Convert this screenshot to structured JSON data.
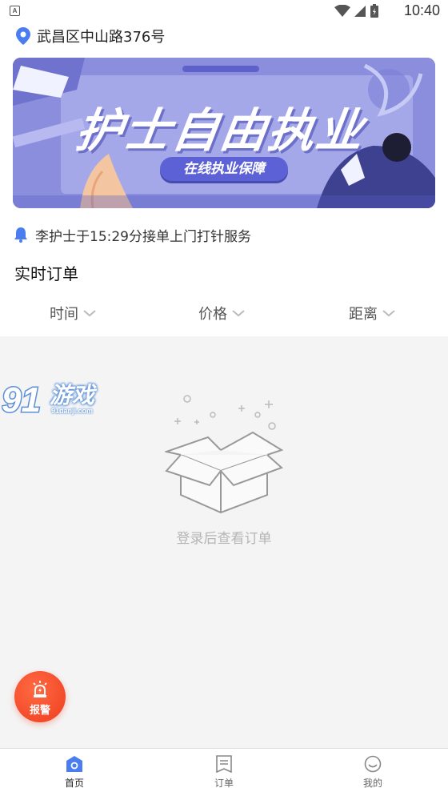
{
  "status_bar": {
    "app_badge": "A",
    "time": "10:40"
  },
  "location": {
    "address": "武昌区中山路376号",
    "icon": "location-pin-icon"
  },
  "banner": {
    "title": "护士自由执业",
    "subtitle": "在线执业保障"
  },
  "notice": {
    "text": "李护士于15:29分接单上门打针服务",
    "icon": "bell-icon"
  },
  "section": {
    "title": "实时订单"
  },
  "filters": [
    {
      "label": "时间"
    },
    {
      "label": "价格"
    },
    {
      "label": "距离"
    }
  ],
  "empty_state": {
    "text": "登录后查看订单"
  },
  "watermark": {
    "brand": "游戏",
    "site": "91danji.com"
  },
  "alarm_button": {
    "label": "报警"
  },
  "tabbar": {
    "items": [
      {
        "label": "首页",
        "active": true,
        "icon": "home-icon"
      },
      {
        "label": "订单",
        "active": false,
        "icon": "order-list-icon"
      },
      {
        "label": "我的",
        "active": false,
        "icon": "profile-face-icon"
      }
    ]
  },
  "colors": {
    "accent": "#4a7df0",
    "banner": "#8f92de",
    "alarm": "#f14a28",
    "content_bg": "#f4f4f5"
  }
}
